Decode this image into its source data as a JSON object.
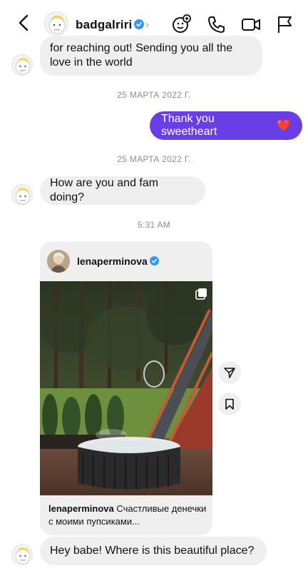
{
  "header": {
    "username": "badgalriri",
    "chevron": "›"
  },
  "messages": {
    "first_line1": "for reaching out! Sending you all the",
    "first_line2": "love in the world",
    "date1": "25 МАРТА 2022 Г.",
    "outgoing": "Thank you sweetheart",
    "outgoing_emoji": "❤️",
    "date2": "25 МАРТА 2022 Г.",
    "question": "How are you and fam doing?",
    "time": "5:31 AM",
    "last": "Hey babe! Where is this beautiful place?"
  },
  "post": {
    "username": "lenaperminova",
    "caption_user": "lenaperminova",
    "caption_text": "Счастливые денечки с моими пупсиками..."
  },
  "icons": [
    "back-arrow-icon",
    "verified-badge-icon",
    "chevron-right-icon",
    "add-effect-icon",
    "phone-icon",
    "video-camera-icon",
    "flag-icon",
    "multiple-photos-icon",
    "share-icon",
    "bookmark-icon"
  ],
  "colors": {
    "outgoing_bubble": "#6a3ee6",
    "incoming_bubble": "#efefef",
    "verified": "#3897f0",
    "timestamp": "#8e8e8e"
  }
}
